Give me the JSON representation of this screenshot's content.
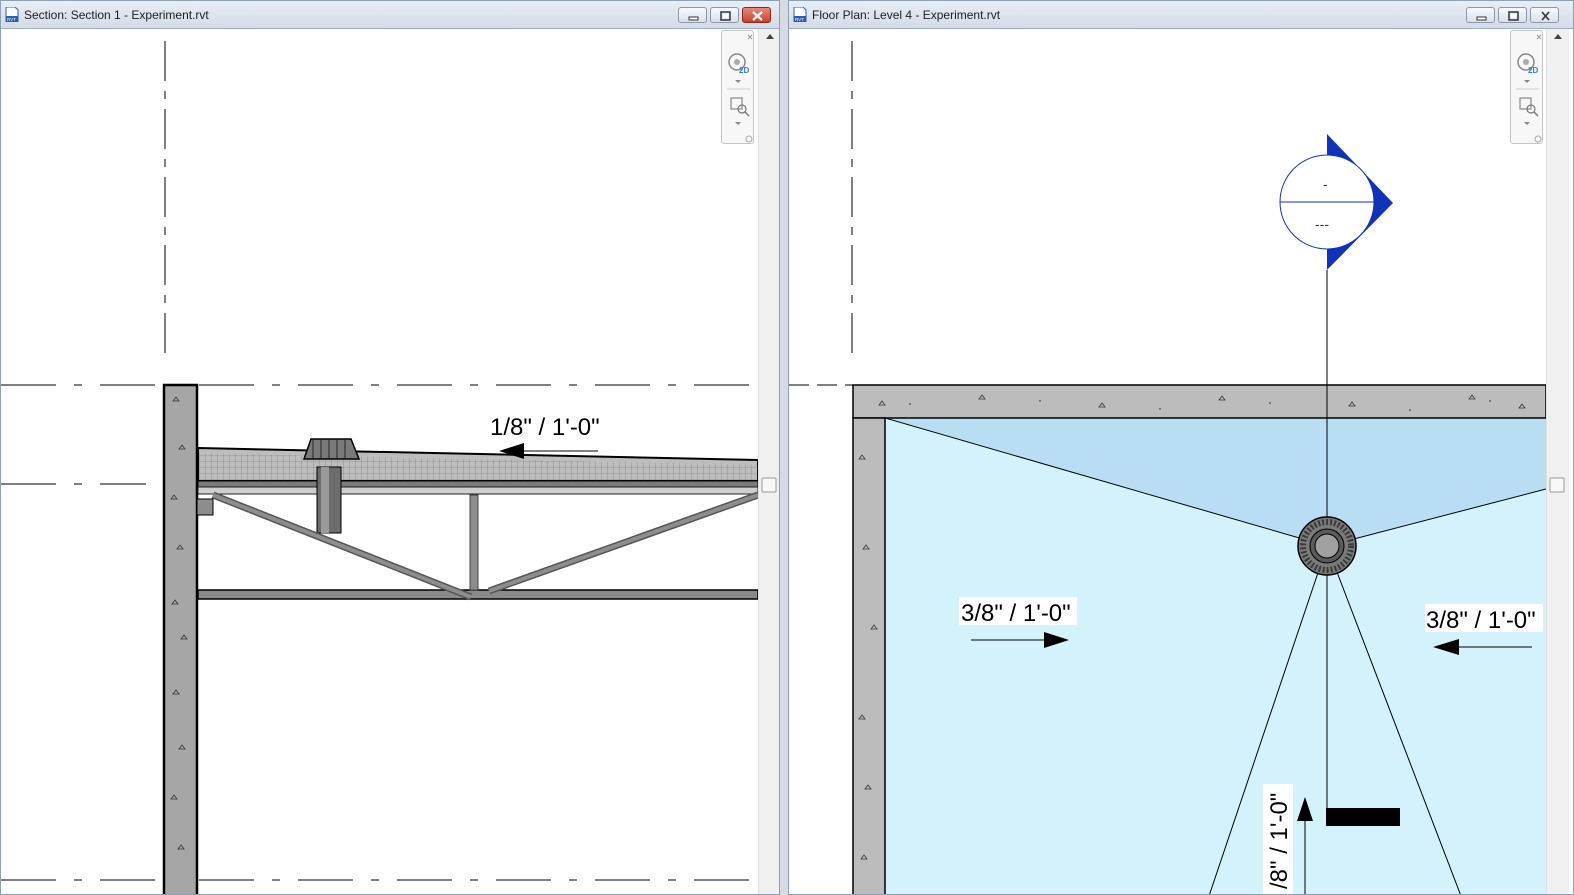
{
  "left_window": {
    "title": "Section: Section 1 - Experiment.rvt",
    "slope_label": "1/8\" / 1'-0\""
  },
  "right_window": {
    "title": "Floor Plan: Level 4 - Experiment.rvt",
    "slope_label_left": "3/8\" / 1'-0\"",
    "slope_label_right": "3/8\" / 1'-0\"",
    "slope_label_vertical": "/8\" / 1'-0\"",
    "elevation_tag_top": "-",
    "elevation_tag_bottom": "---"
  },
  "nav_bar": {
    "zoom_badge": "2D"
  },
  "icons": {
    "app_file": "rvt-document-icon",
    "minimize": "minimize-icon",
    "restore": "restore-icon",
    "close": "close-icon",
    "steering_wheel": "steering-wheel-icon",
    "zoom": "zoom-region-icon",
    "dropdown": "chevron-down-icon"
  },
  "colors": {
    "title_gradient_top": "#e9eef5",
    "title_gradient_bottom": "#d3dbe6",
    "close_active": "#c9412c",
    "slab_fill": "#bcbcbc",
    "floor_light": "#d4f2fc",
    "floor_dark": "#b9ddf3",
    "tag_blue": "#1133bb"
  }
}
